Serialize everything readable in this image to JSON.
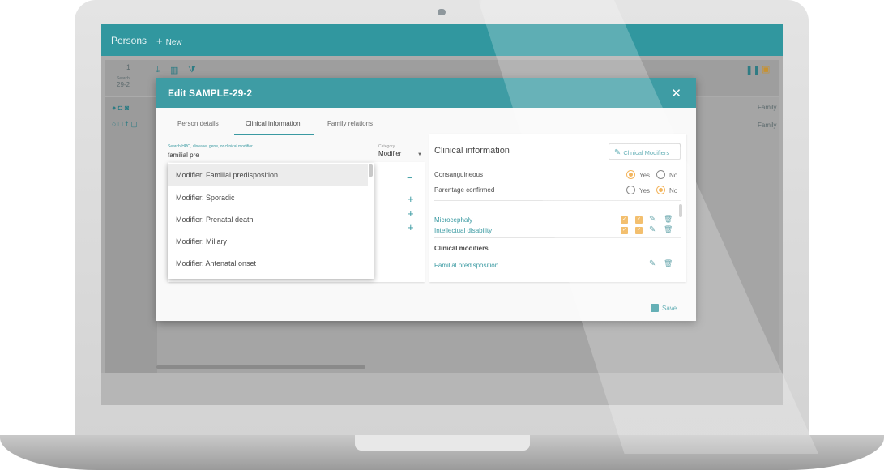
{
  "app": {
    "title": "Persons",
    "new_label": "New"
  },
  "background": {
    "count": "1",
    "search_label": "Search",
    "search_value": "29-2",
    "column_family": "Family",
    "cell_family": "Family"
  },
  "dialog": {
    "title": "Edit SAMPLE-29-2",
    "close_label": "✕",
    "tabs": [
      {
        "label": "Person details"
      },
      {
        "label": "Clinical information"
      },
      {
        "label": "Family relations"
      }
    ],
    "active_tab": "Clinical information",
    "search": {
      "label": "Search HPO, disease, gene, or clinical modifier",
      "value": "familial pre"
    },
    "category": {
      "label": "Category",
      "value": "Modifier"
    },
    "dropdown": {
      "highlighted": "Modifier: Familial predisposition",
      "options": [
        {
          "label": "Modifier: Familial predisposition"
        },
        {
          "label": "Modifier: Sporadic"
        },
        {
          "label": "Modifier: Prenatal death"
        },
        {
          "label": "Modifier: Miliary"
        },
        {
          "label": "Modifier: Antenatal onset"
        }
      ]
    },
    "clinical": {
      "title": "Clinical information",
      "modifiers_button": "Clinical Modifiers",
      "consanguineous": {
        "label": "Consanguineous",
        "yes": "Yes",
        "no": "No",
        "value": "Yes"
      },
      "parentage": {
        "label": "Parentage confirmed",
        "yes": "Yes",
        "no": "No",
        "value": "No"
      },
      "terms": [
        {
          "label": "Microcephaly"
        },
        {
          "label": "Intellectual disability"
        }
      ],
      "modifiers_heading": "Clinical modifiers",
      "modifiers": [
        {
          "label": "Familial predisposition"
        }
      ]
    },
    "save_label": "Save"
  },
  "colors": {
    "teal": "#3a9aa2",
    "appbar": "#31979f",
    "orange": "#f0a030"
  },
  "icons": {
    "add": "plus-icon",
    "remove": "minus-icon",
    "edit": "pencil-icon",
    "delete": "trash-icon",
    "save": "floppy-disk-icon"
  }
}
